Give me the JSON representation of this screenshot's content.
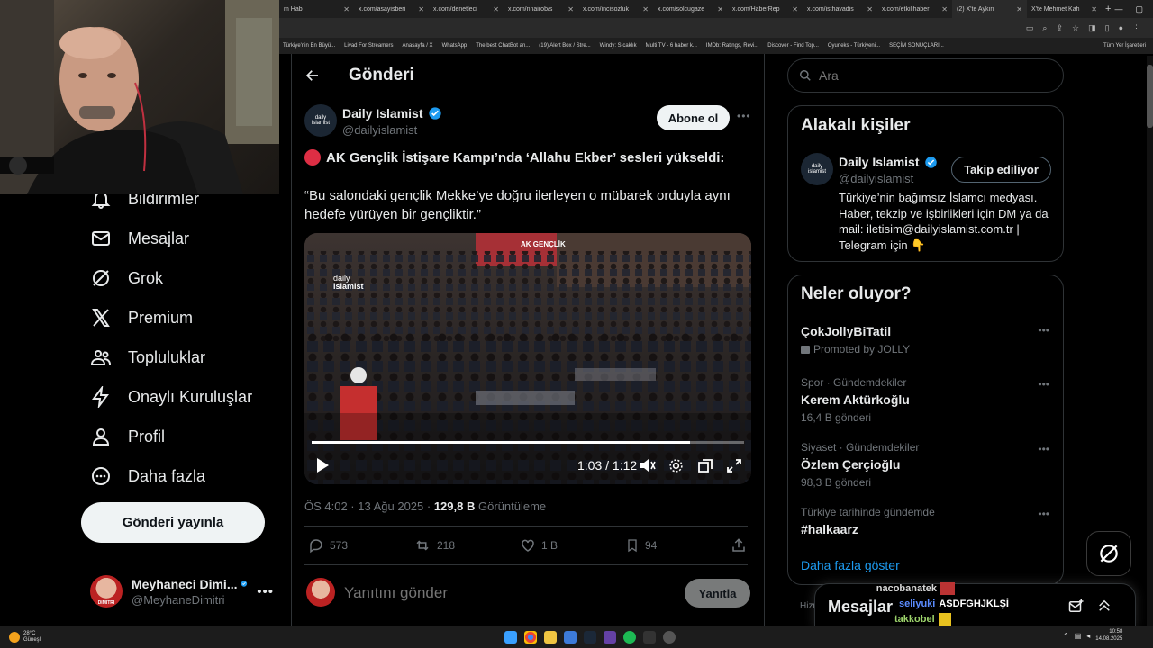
{
  "browser": {
    "tabs": [
      {
        "label": "m Hab"
      },
      {
        "label": "x.com/asayisberi"
      },
      {
        "label": "x.com/denetleci"
      },
      {
        "label": "x.com/nnairob/s"
      },
      {
        "label": "x.com/incisozluk"
      },
      {
        "label": "x.com/solcugaze"
      },
      {
        "label": "x.com/HaberRep"
      },
      {
        "label": "x.com/isthavadis"
      },
      {
        "label": "x.com/etkilihaber"
      },
      {
        "label": "(2) X'te Aykırı"
      },
      {
        "label": "X'te Mehmet Kah"
      }
    ],
    "bookmarks": [
      "Türkiye'nin En Büyü...",
      "Livad For Streamers",
      "Anasayfa / X",
      "WhatsApp",
      "The best ChatBot an...",
      "(19) Alert Box / Stre...",
      "Windy: Sıcaklık",
      "Multi TV - 6 haber k...",
      "IMDb: Ratings, Revi...",
      "Discover - Find Top...",
      "Oyuneks - Türkiyeni...",
      "SEÇİM SONUÇLARI..."
    ],
    "all_bookmarks": "Tüm Yer İşaretleri"
  },
  "sidebar": {
    "items": [
      {
        "label": "Bildirimler"
      },
      {
        "label": "Mesajlar"
      },
      {
        "label": "Grok"
      },
      {
        "label": "Premium"
      },
      {
        "label": "Topluluklar"
      },
      {
        "label": "Onaylı Kuruluşlar"
      },
      {
        "label": "Profil"
      },
      {
        "label": "Daha fazla"
      }
    ],
    "post_button": "Gönderi yayınla",
    "account": {
      "name": "Meyhaneci Dimi...",
      "handle": "@MeyhaneDimitri",
      "avatar_text": "DIMITRI"
    }
  },
  "main": {
    "header_title": "Gönderi",
    "author": {
      "name": "Daily Islamist",
      "handle": "@dailyislamist",
      "avatar_text": "daily islamist"
    },
    "follow_button": "Abone ol",
    "headline": "AK Gençlik İstişare Kampı’nda ‘Allahu Ekber’ sesleri yükseldi:",
    "quote": "“Bu salondaki gençlik Mekke’ye doğru ilerleyen o mübarek orduyla aynı hedefe yürüyen bir gençliktir.”",
    "video": {
      "watermark_top": "daily",
      "watermark_bottom": "islamist",
      "banner_text": "AK GENÇLİK",
      "time": "1:03 / 1:12",
      "progress": 0.875
    },
    "meta": {
      "time": "ÖS 4:02 · 13 Ağu 2025 · ",
      "views_count": "129,8 B",
      "views_label": " Görüntüleme"
    },
    "actions": {
      "replies": "573",
      "reposts": "218",
      "likes": "1 B",
      "bookmarks": "94"
    },
    "reply_placeholder": "Yanıtını gönder",
    "reply_button": "Yanıtla"
  },
  "right": {
    "search_placeholder": "Ara",
    "related": {
      "title": "Alakalı kişiler",
      "name": "Daily Islamist",
      "handle": "@dailyislamist",
      "follow_state": "Takip ediliyor",
      "bio": "Türkiye’nin bağımsız İslamcı medyası. Haber, tekzip ve işbirlikleri için DM ya da mail: iletisim@dailyislamist.com.tr | Telegram için 👇"
    },
    "trends": {
      "title": "Neler oluyor?",
      "items": [
        {
          "context": "",
          "name": "ÇokJollyBiTatil",
          "meta": "Promoted by JOLLY"
        },
        {
          "context": "Spor · Gündemdekiler",
          "name": "Kerem Aktürkoğlu",
          "meta": "16,4 B gönderi"
        },
        {
          "context": "Siyaset · Gündemdekiler",
          "name": "Özlem Çerçioğlu",
          "meta": "98,3 B gönderi"
        },
        {
          "context": "Türkiye tarihinde gündemde",
          "name": "#halkaarz",
          "meta": ""
        }
      ],
      "show_more": "Daha fazla göster"
    },
    "messages_label": "Mesajlar"
  },
  "chat": [
    {
      "user": "nacobanatek",
      "msg": "",
      "color": "#d8d8d8"
    },
    {
      "user": "seliyuki",
      "msg": "ASDFGHJKLŞİ",
      "color": "#5b8cff"
    },
    {
      "user": "takkobel",
      "msg": "",
      "color": "#9bd26a"
    },
    {
      "user": "seliyuki",
      "msg": "",
      "color": "#5b8cff"
    }
  ],
  "taskbar": {
    "weather_temp": "28°C",
    "weather_desc": "Güneşli",
    "clock_time": "10:58",
    "clock_date": "14.08.2025"
  }
}
